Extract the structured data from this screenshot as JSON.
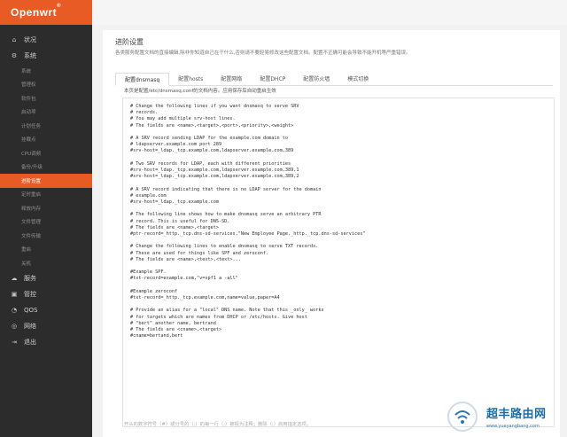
{
  "brand": {
    "name": "Openwrt",
    "mark": "®"
  },
  "sidebar": {
    "items": [
      {
        "label": "状况",
        "icon": "home-icon",
        "type": "top"
      },
      {
        "label": "系统",
        "icon": "gear-icon",
        "type": "top"
      },
      {
        "label": "系统",
        "type": "sub"
      },
      {
        "label": "管理权",
        "type": "sub"
      },
      {
        "label": "软件包",
        "type": "sub"
      },
      {
        "label": "启动项",
        "type": "sub"
      },
      {
        "label": "计划任务",
        "type": "sub"
      },
      {
        "label": "挂载点",
        "type": "sub"
      },
      {
        "label": "CPU调频",
        "type": "sub"
      },
      {
        "label": "备份/升级",
        "type": "sub"
      },
      {
        "label": "进阶设置",
        "type": "sub",
        "active": true
      },
      {
        "label": "定时重启",
        "type": "sub"
      },
      {
        "label": "释放内存",
        "type": "sub"
      },
      {
        "label": "文件管理",
        "type": "sub"
      },
      {
        "label": "文件传输",
        "type": "sub"
      },
      {
        "label": "重启",
        "type": "sub"
      },
      {
        "label": "关机",
        "type": "sub"
      },
      {
        "label": "服务",
        "icon": "cloud-icon",
        "type": "top"
      },
      {
        "label": "管控",
        "icon": "lock-icon",
        "type": "top"
      },
      {
        "label": "QOS",
        "icon": "qos-icon",
        "type": "top"
      },
      {
        "label": "网络",
        "icon": "network-icon",
        "type": "top"
      },
      {
        "label": "退出",
        "icon": "logout-icon",
        "type": "top"
      }
    ]
  },
  "page": {
    "title": "进阶设置",
    "description": "各类服务配置文档的直接编辑,除非你知道自己在干什么,否则请不要轻易修改这些配置文档。配置不正确可能会导致不能开机等严重错误。"
  },
  "tabs": [
    {
      "label": "配置dnsmasq",
      "active": true
    },
    {
      "label": "配置hosts"
    },
    {
      "label": "配置网络"
    },
    {
      "label": "配置DHCP"
    },
    {
      "label": "配置防火墙"
    },
    {
      "label": "模式切换"
    }
  ],
  "tab_description": "本页是配置/etc/dnsmasq.conf的文档内容。应用保存后自动重启生效",
  "editor": {
    "lines": [
      "# Change the following lines if you want dnsmasq to serve SRV",
      "# records.",
      "# You may add multiple srv-host lines.",
      "# The fields are <name>,<target>,<port>,<priority>,<weight>",
      "",
      "# A SRV record sending LDAP for the example.com domain to",
      "# ldapserver.example.com port 289",
      "#srv-host=_ldap._tcp.example.com,ldapserver.example.com,389",
      "",
      "# Two SRV records for LDAP, each with different priorities",
      "#srv-host=_ldap._tcp.example.com,ldapserver.example.com,389,1",
      "#srv-host=_ldap._tcp.example.com,ldapserver.example.com,389,2",
      "",
      "# A SRV record indicating that there is no LDAP server for the domain",
      "# example.com",
      "#srv-host=_ldap._tcp.example.com",
      "",
      "# The following line shows how to make dnsmasq serve an arbitrary PTR",
      "# record. This is useful for DNS-SD.",
      "# The fields are <name>,<target>",
      "#ptr-record=_http._tcp.dns-sd-services,\"New Employee Page._http._tcp.dns-sd-services\"",
      "",
      "# Change the following lines to enable dnsmasq to serve TXT records.",
      "# These are used for things like SPF and zeroconf.",
      "# The fields are <name>,<text>,<text>...",
      "",
      "#Example SPF.",
      "#txt-record=example.com,\"v=spf1 a -all\"",
      "",
      "#Example zeroconf",
      "#txt-record=_http._tcp.example.com,name=value,paper=A4",
      "",
      "# Provide an alias for a \"local\" DNS name. Note that this _only_ works",
      "# for targets which are names from DHCP or /etc/hosts. Give host",
      "# \"bert\" another name, bertrand",
      "# The fields are <cname>,<target>",
      "#cname=bertand,bert"
    ]
  },
  "footer_hint": "开头的数字符号（#）或分号的（;）的每一行（;）被视为注释；删除（;）启用指定选项。",
  "watermark": {
    "text": "超丰路由网",
    "url": "www.yueyangbang.com"
  }
}
